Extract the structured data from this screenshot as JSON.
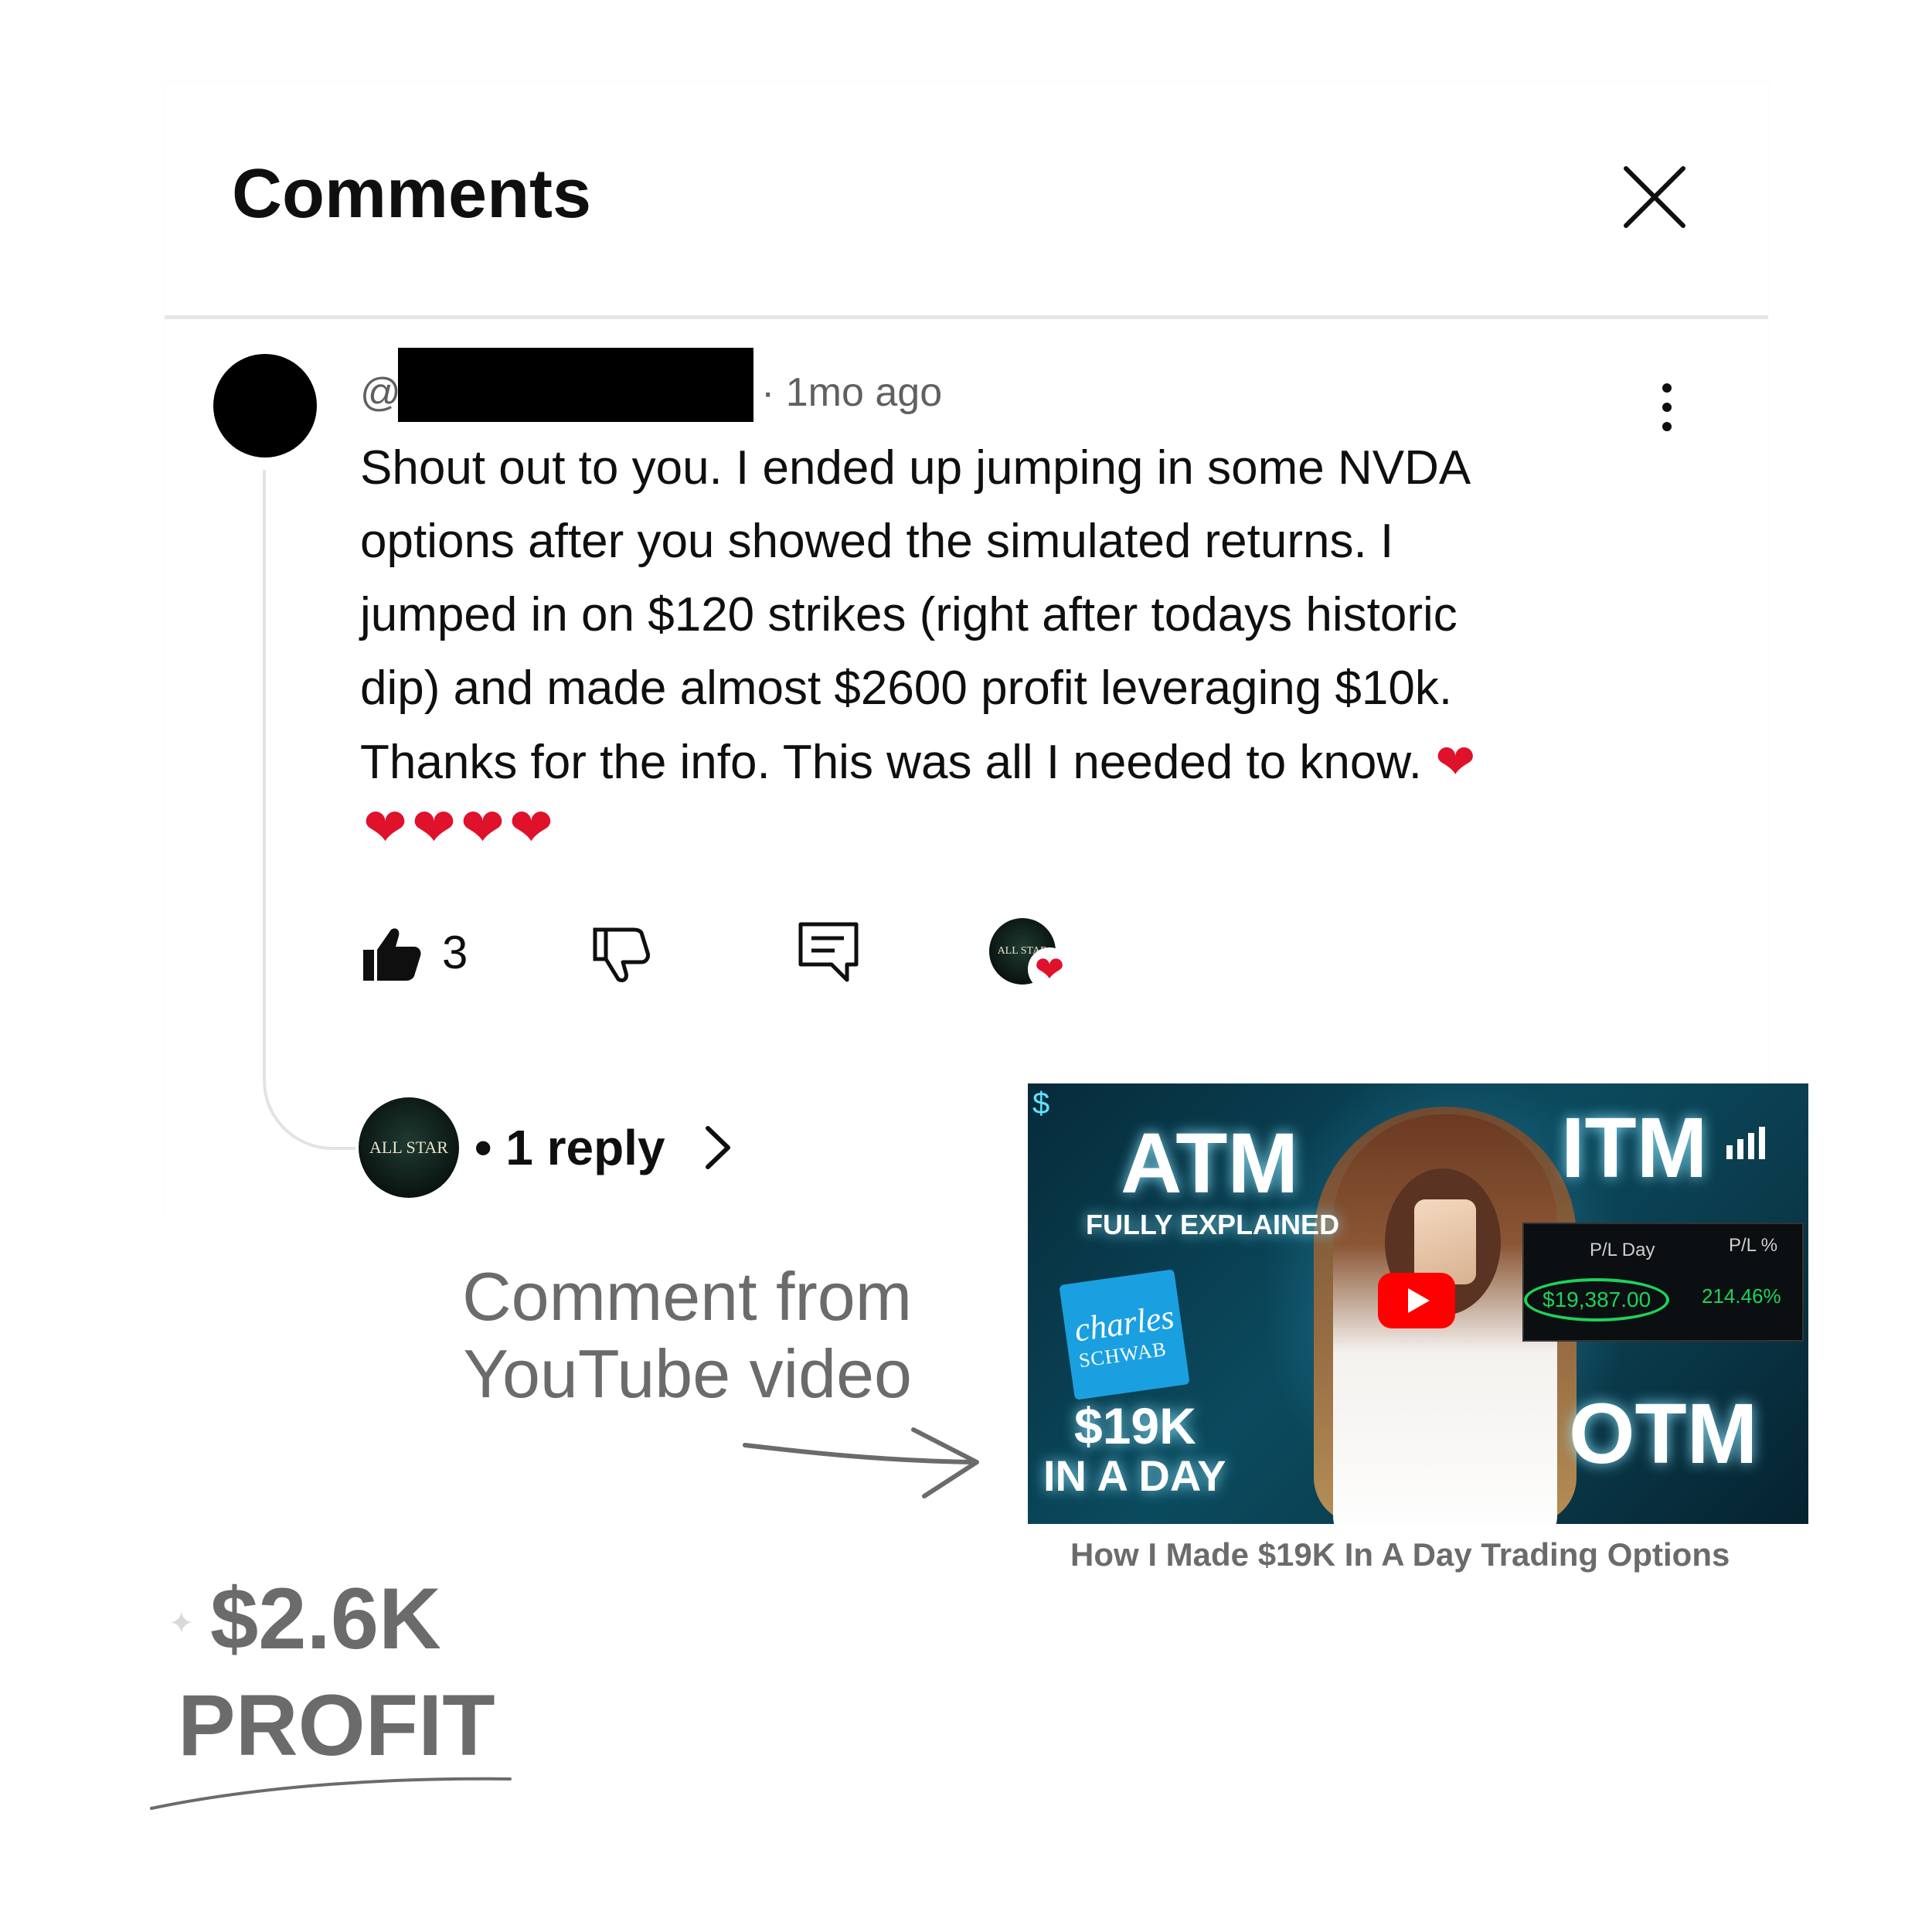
{
  "header": {
    "title": "Comments"
  },
  "comment": {
    "handle_prefix": "@",
    "time": "· 1mo ago",
    "lines": [
      "Shout out to you. I ended up jumping in some NVDA",
      "options after you showed the simulated returns. I",
      "jumped in on $120 strikes (right after todays historic",
      "dip) and made almost $2600 profit leveraging $10k.",
      "Thanks for the info.  This was all I needed to know."
    ],
    "trailing_heart": "❤",
    "hearts_row": "❤❤❤❤",
    "likes": "3",
    "reply_label": "• 1 reply"
  },
  "annotation": {
    "caption_line1": "Comment from",
    "caption_line2": "YouTube video",
    "profit_amount": "$2.6K",
    "profit_label": "PROFIT"
  },
  "video": {
    "title": "How I Made $19K In A Day Trading Options",
    "thumbnail": {
      "atm": "ATM",
      "fully_explained": "FULLY EXPLAINED",
      "itm": "ITM",
      "otm": "OTM",
      "big_amount": "$19K",
      "in_a_day": "IN A DAY",
      "brand_line1": "charles",
      "brand_line2": "SCHWAB",
      "pl_day_label": "P/L Day",
      "pl_pct_label": "P/L %",
      "pl_day_value": "$19,387.00",
      "pl_pct_value": "214.46%",
      "dollar_sign": "$",
      "creator_badge": "ALL STAR"
    }
  },
  "colors": {
    "text_primary": "#0f0f0f",
    "text_secondary": "#606060",
    "annotation_gray": "#6b6b6b",
    "heart_red": "#e0112b",
    "youtube_red": "#ff0000",
    "pl_green": "#1fd15a"
  },
  "icons": [
    "close-icon",
    "more-vert-icon",
    "like-icon",
    "dislike-icon",
    "reply-icon",
    "creator-heart-icon",
    "chevron-right-icon",
    "play-icon",
    "arrow-icon"
  ]
}
